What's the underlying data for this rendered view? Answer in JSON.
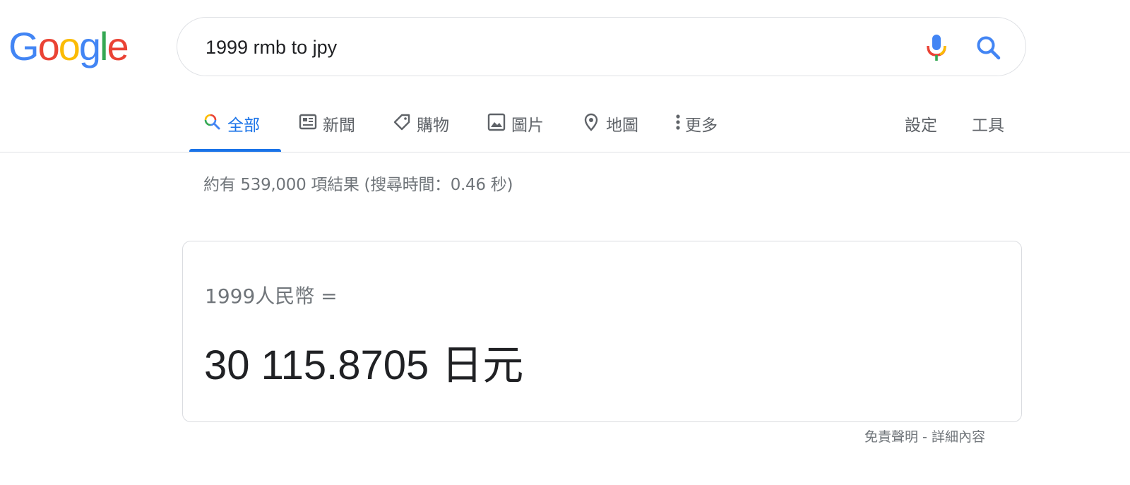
{
  "logo": {
    "letters": [
      "G",
      "o",
      "o",
      "g",
      "l",
      "e"
    ],
    "colors": [
      "#4285F4",
      "#EA4335",
      "#FBBC05",
      "#4285F4",
      "#34A853",
      "#EA4335"
    ]
  },
  "search": {
    "query": "1999 rmb to jpy",
    "mic_icon": "mic-icon",
    "search_icon": "search-icon"
  },
  "tabs": [
    {
      "label": "全部",
      "icon": "search-icon",
      "active": true
    },
    {
      "label": "新聞",
      "icon": "news-icon",
      "active": false
    },
    {
      "label": "購物",
      "icon": "tag-icon",
      "active": false
    },
    {
      "label": "圖片",
      "icon": "image-icon",
      "active": false
    },
    {
      "label": "地圖",
      "icon": "map-pin-icon",
      "active": false
    },
    {
      "label": "更多",
      "icon": "more-vert-icon",
      "active": false
    }
  ],
  "tools": {
    "settings": "設定",
    "tools": "工具"
  },
  "result_stats": "約有 539,000 項結果 (搜尋時間：0.46 秒)",
  "converter": {
    "from_text": "1999人民幣 =",
    "result_value": "30 115.8705",
    "result_unit": "日元"
  },
  "footer": {
    "disclaimer": "免責聲明",
    "separator": " - ",
    "details": "詳細內容"
  },
  "colors": {
    "accent": "#1a73e8",
    "text_secondary": "#70757a",
    "text_primary": "#202124",
    "border": "#dfe1e5"
  }
}
